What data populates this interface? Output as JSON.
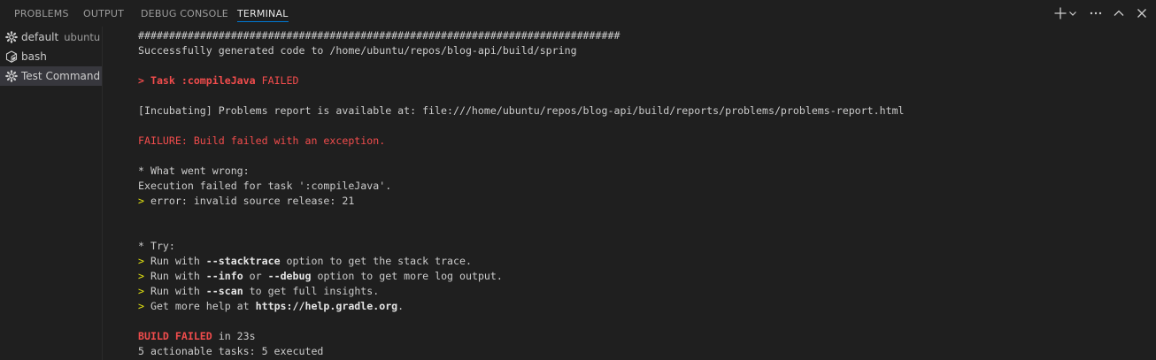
{
  "tabs": [
    {
      "label": "PROBLEMS",
      "active": false
    },
    {
      "label": "OUTPUT",
      "active": false
    },
    {
      "label": "DEBUG CONSOLE",
      "active": false
    },
    {
      "label": "TERMINAL",
      "active": true
    }
  ],
  "toolbar": {
    "new_terminal_icon": "plus-icon",
    "dropdown_icon": "chevron-down-icon",
    "more_icon": "ellipsis-icon",
    "maximize_icon": "chevron-up-icon",
    "close_icon": "close-icon"
  },
  "terminals": [
    {
      "label": "default",
      "desc": "ubuntu",
      "icon": "gear-icon",
      "selected": false
    },
    {
      "label": "bash",
      "desc": "",
      "icon": "terminal-bash-icon",
      "selected": false
    },
    {
      "label": "Test Command",
      "desc": "",
      "icon": "gear-icon",
      "selected": true
    }
  ],
  "output": {
    "hash_line": "##############################################################################",
    "generated": "Successfully generated code to /home/ubuntu/repos/blog-api/build/spring",
    "task_prefix": "> Task :compileJava",
    "task_status": " FAILED",
    "incubating": "[Incubating] Problems report is available at: file:///home/ubuntu/repos/blog-api/build/reports/problems/problems-report.html",
    "failure": "FAILURE: Build failed with an exception.",
    "what_went_wrong": "* What went wrong:",
    "exec_failed": "Execution failed for task ':compileJava'.",
    "error_prompt": ">",
    "error_text": " error: invalid source release: 21",
    "try": "* Try:",
    "try_items": [
      {
        "prompt": ">",
        "a": " Run with ",
        "b": "--stacktrace",
        "c": " option to get the stack trace.",
        "d": "",
        "e": ""
      },
      {
        "prompt": ">",
        "a": " Run with ",
        "b": "--info",
        "c": " or ",
        "d": "--debug",
        "e": " option to get more log output."
      },
      {
        "prompt": ">",
        "a": " Run with ",
        "b": "--scan",
        "c": " to get full insights.",
        "d": "",
        "e": ""
      },
      {
        "prompt": ">",
        "a": " Get more help at ",
        "b": "https://help.gradle.org",
        "c": ".",
        "d": "",
        "e": ""
      }
    ],
    "build_failed": "BUILD FAILED",
    "build_time": " in 23s",
    "actionable": "5 actionable tasks: 5 executed"
  },
  "colors": {
    "background": "#1f1f1f",
    "active_tab_underline": "#0078d4",
    "error_red": "#f14c4c",
    "prompt_yellow": "#e5e510",
    "selected_bg": "#37373d"
  }
}
